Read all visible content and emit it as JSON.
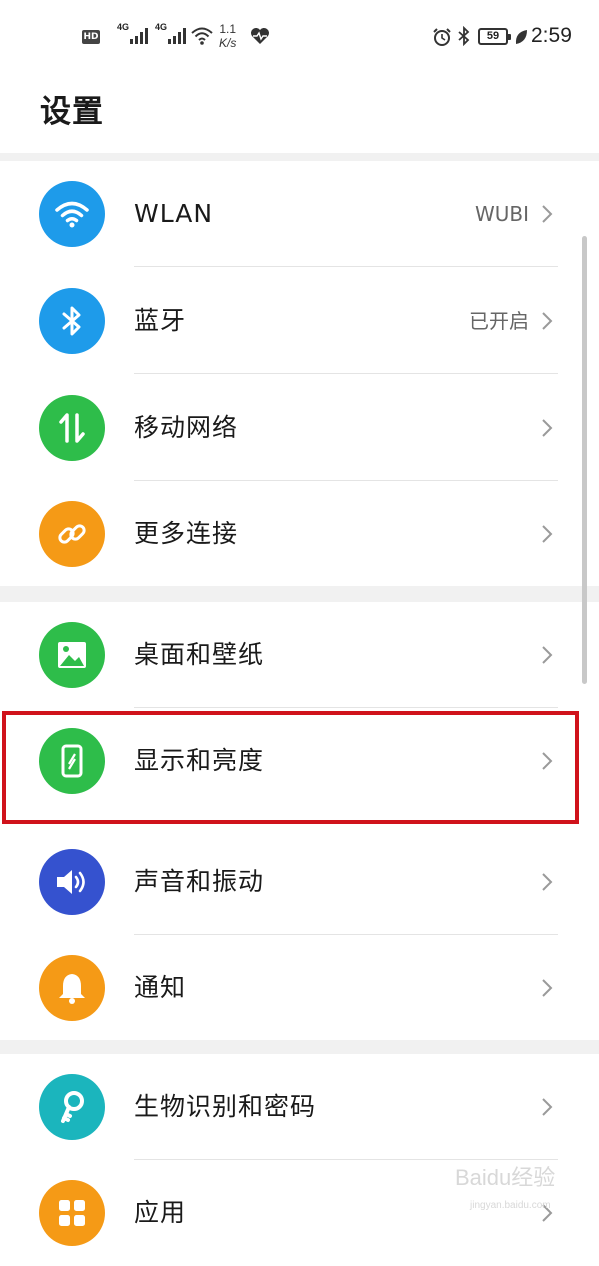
{
  "status_bar": {
    "hd": "HD",
    "net1": "4G",
    "net2": "4G",
    "speed_value": "1.1",
    "speed_unit": "K/s",
    "battery": "59",
    "time": "2:59"
  },
  "title": "设置",
  "rows": [
    {
      "label": "WLAN",
      "value": "WUBI",
      "icon": "wifi-icon",
      "color": "#1e9bea"
    },
    {
      "label": "蓝牙",
      "value": "已开启",
      "icon": "bluetooth-icon",
      "color": "#1e9bea"
    },
    {
      "label": "移动网络",
      "value": "",
      "icon": "mobile-data-icon",
      "color": "#2ebd4a"
    },
    {
      "label": "更多连接",
      "value": "",
      "icon": "link-icon",
      "color": "#f59a16"
    },
    {
      "label": "桌面和壁纸",
      "value": "",
      "icon": "wallpaper-icon",
      "color": "#2ebd4a"
    },
    {
      "label": "显示和亮度",
      "value": "",
      "icon": "display-icon",
      "color": "#2ebd4a"
    },
    {
      "label": "声音和振动",
      "value": "",
      "icon": "sound-icon",
      "color": "#3552cf"
    },
    {
      "label": "通知",
      "value": "",
      "icon": "bell-icon",
      "color": "#f59a16"
    },
    {
      "label": "生物识别和密码",
      "value": "",
      "icon": "key-icon",
      "color": "#1bb5bd"
    },
    {
      "label": "应用",
      "value": "",
      "icon": "apps-icon",
      "color": "#f59a16"
    }
  ],
  "watermark": "Baidu经验",
  "watermark_sub": "jingyan.baidu.com"
}
